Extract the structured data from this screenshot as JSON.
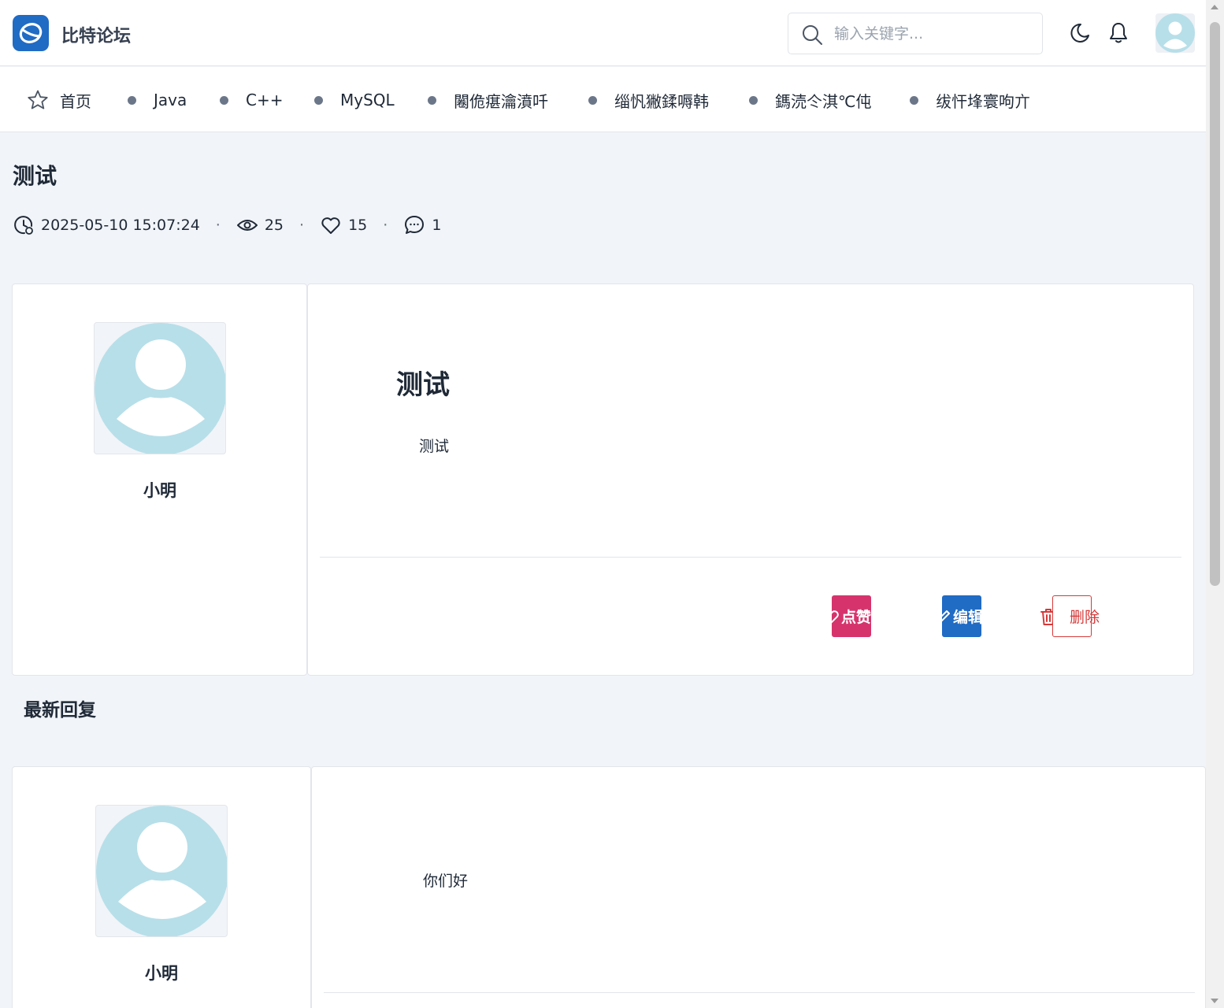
{
  "header": {
    "brand": "比特论坛",
    "logo_icon": "forum-logo-icon",
    "search_placeholder": "输入关键字...",
    "theme_icon": "moon-icon",
    "notify_icon": "bell-icon",
    "avatar_icon": "user-avatar-icon"
  },
  "nav": {
    "items": [
      {
        "label": "首页",
        "icon": "star-icon"
      },
      {
        "label": "Java"
      },
      {
        "label": "C++"
      },
      {
        "label": "MySQL"
      },
      {
        "label": "闂佹瘎瀹濆吀"
      },
      {
        "label": "缁忛獙鍒嗕韩"
      },
      {
        "label": "鎷涜仒淇℃伅"
      },
      {
        "label": "绂忓埄寰呴亣"
      }
    ]
  },
  "article": {
    "title": "测试",
    "meta": {
      "time": "2025-05-10 15:07:24",
      "views": "25",
      "likes": "15",
      "comments": "1",
      "separator": "·"
    },
    "author": "小明",
    "content_heading": "测试",
    "content_text": "测试",
    "actions": {
      "like_label": "点赞",
      "edit_label": "编辑",
      "delete_label": "删除"
    }
  },
  "replies": {
    "section_title": "最新回复",
    "items": [
      {
        "author": "小明",
        "content": "你们好"
      }
    ]
  },
  "colors": {
    "primary": "#206bc4",
    "like": "#d6336c",
    "danger": "#d63939",
    "avatar": "#b7dfe9",
    "background": "#f1f4f8"
  }
}
